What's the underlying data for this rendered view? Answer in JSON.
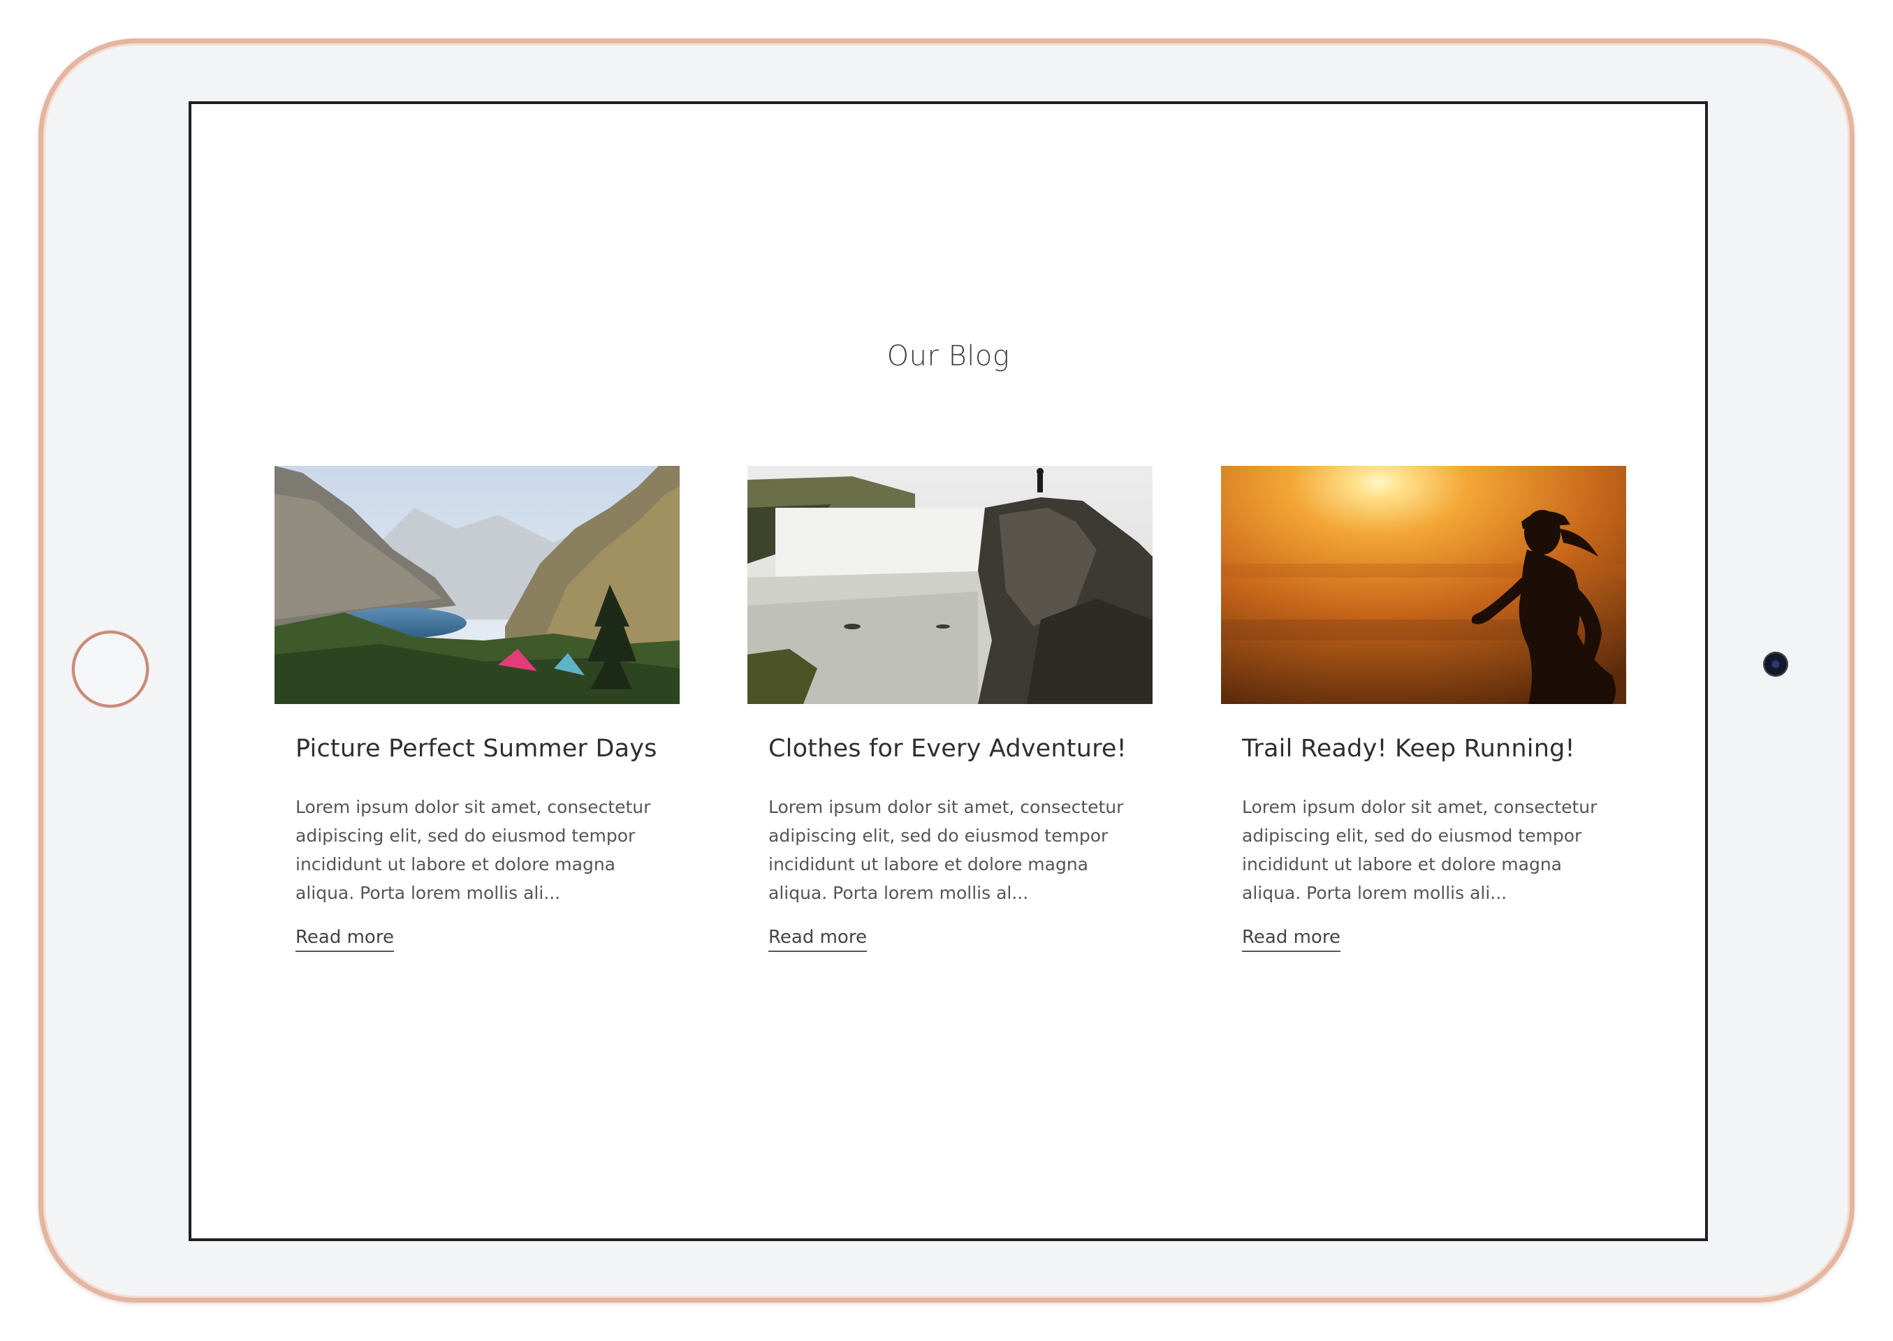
{
  "blog": {
    "title": "Our Blog",
    "posts": [
      {
        "title": "Picture Perfect Summer Days",
        "excerpt": "Lorem ipsum dolor sit amet, consectetur adipiscing elit, sed do eiusmod tempor incididunt ut labore et dolore magna aliqua. Porta lorem mollis ali...",
        "link_label": "Read more",
        "image": "mountain-lake-camping-photo"
      },
      {
        "title": "Clothes for Every Adventure!",
        "excerpt": "Lorem ipsum dolor sit amet, consectetur adipiscing elit, sed do eiusmod tempor incididunt ut labore et dolore magna aliqua. Porta lorem mollis al...",
        "link_label": "Read more",
        "image": "waterfall-cliff-photo"
      },
      {
        "title": "Trail Ready! Keep Running!",
        "excerpt": "Lorem ipsum dolor sit amet, consectetur adipiscing elit, sed do eiusmod tempor incididunt ut labore et dolore magna aliqua. Porta lorem mollis ali...",
        "link_label": "Read more",
        "image": "sunset-runner-photo"
      }
    ]
  },
  "colors": {
    "device_frame": "#e3b6a0",
    "device_body": "#f3f4f6",
    "screen_border": "#1f2025",
    "text": "#3b3b3b"
  }
}
